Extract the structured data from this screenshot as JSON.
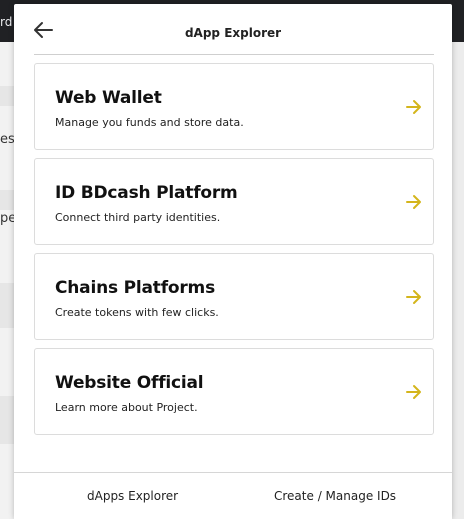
{
  "backdrop": {
    "topbar_fragment": "rd",
    "side_fragments": [
      "es",
      "pe"
    ]
  },
  "header": {
    "title": "dApp Explorer",
    "back_icon": "arrow-left-icon"
  },
  "cards": [
    {
      "title": "Web Wallet",
      "description": "Manage you funds and store data.",
      "icon": "arrow-right-icon"
    },
    {
      "title": "ID BDcash Platform",
      "description": "Connect third party identities.",
      "icon": "arrow-right-icon"
    },
    {
      "title": "Chains Platforms",
      "description": "Create tokens with few clicks.",
      "icon": "arrow-right-icon"
    },
    {
      "title": "Website Official",
      "description": "Learn more about Project.",
      "icon": "arrow-right-icon"
    }
  ],
  "footer": {
    "left_tab": "dApps Explorer",
    "right_tab": "Create / Manage IDs"
  },
  "colors": {
    "accent_arrow": "#d4b51c",
    "text": "#111111",
    "border": "#dcdcdc"
  }
}
